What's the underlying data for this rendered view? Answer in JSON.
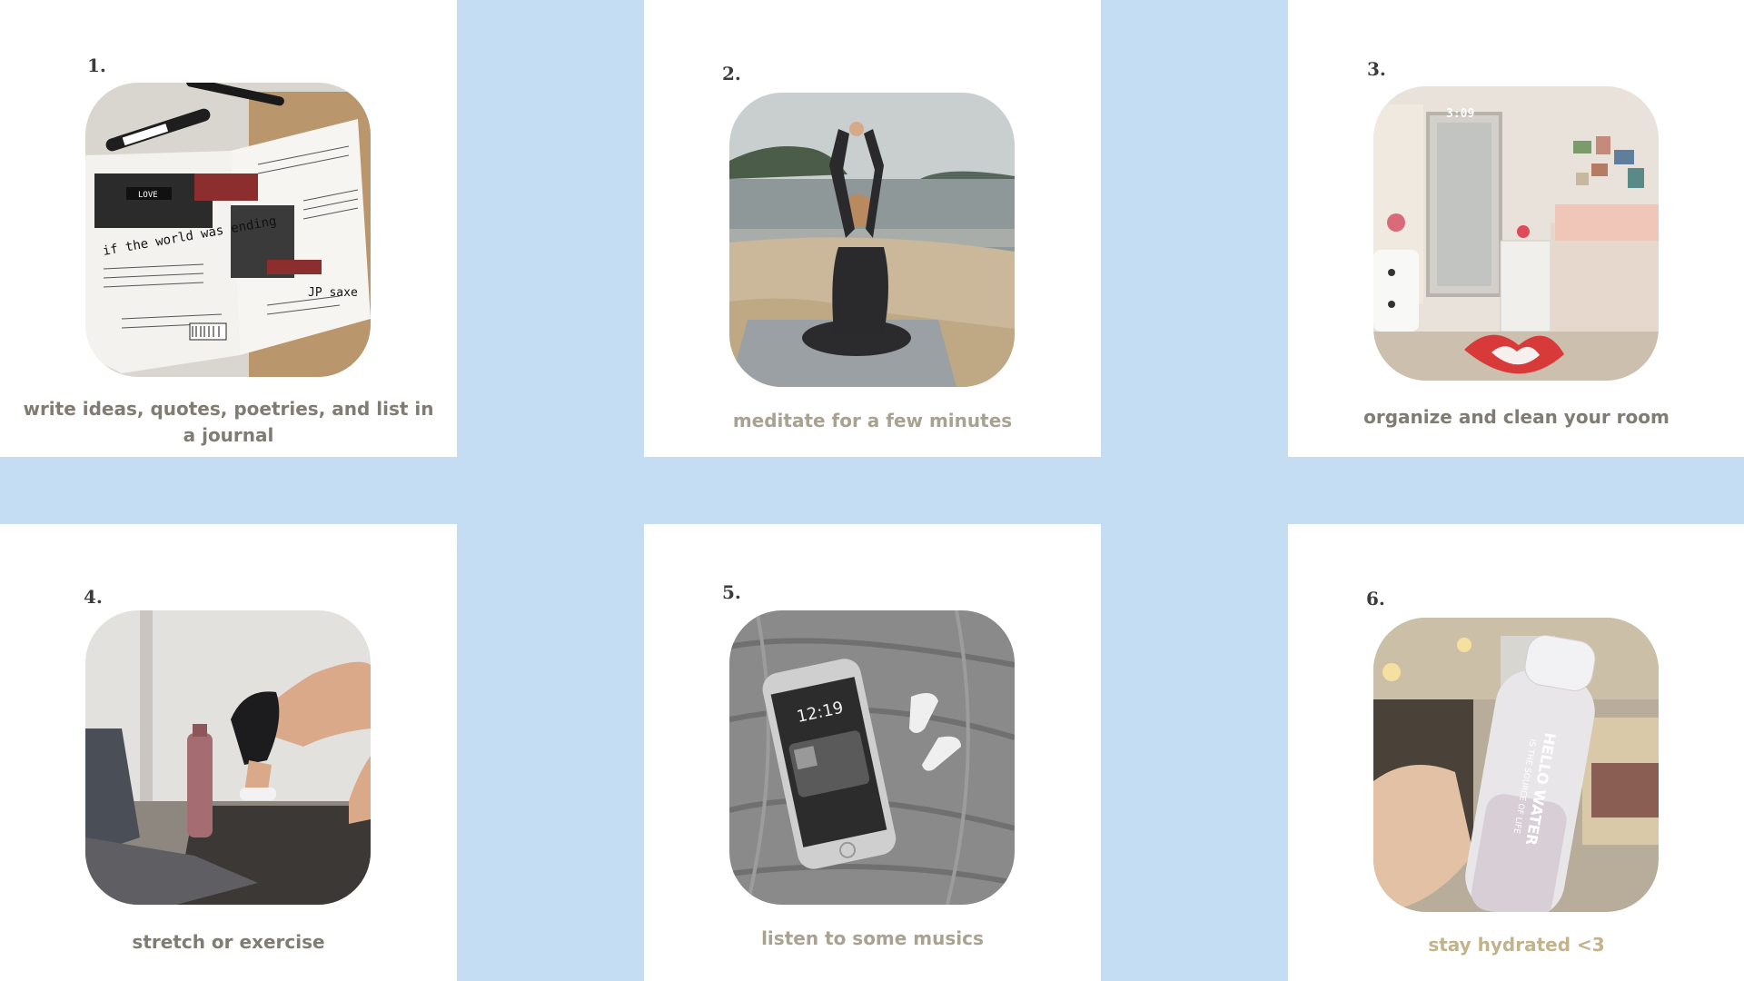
{
  "cards": [
    {
      "number": "1.",
      "caption": "write ideas, quotes, poetries, and list in a journal",
      "photo": "journal-photo"
    },
    {
      "number": "2.",
      "caption": "meditate for a few minutes",
      "photo": "beach-meditation-photo"
    },
    {
      "number": "3.",
      "caption": "organize and clean your room",
      "photo": "bedroom-photo"
    },
    {
      "number": "4.",
      "caption": "stretch or exercise",
      "photo": "exercise-photo"
    },
    {
      "number": "5.",
      "caption": "listen to some musics",
      "photo": "phone-airpods-photo"
    },
    {
      "number": "6.",
      "caption": "stay hydrated <3",
      "photo": "water-bottle-photo"
    }
  ],
  "photo_text": {
    "journal_left_heading": "if the world was ending",
    "journal_tag": "LOVE",
    "journal_right_word": "JP saxe",
    "room_clock": "3:09",
    "phone_time": "12:19",
    "bottle_text": "HELLO WATER",
    "bottle_subtext": "IS THE SOURCE OF LIFE"
  },
  "colors": {
    "background": "#c4ddf2",
    "card": "#ffffff",
    "number": "#3b3b3b",
    "caption": "#817c73",
    "caption_light": "#a9a290",
    "caption_tan": "#c2b38d"
  }
}
